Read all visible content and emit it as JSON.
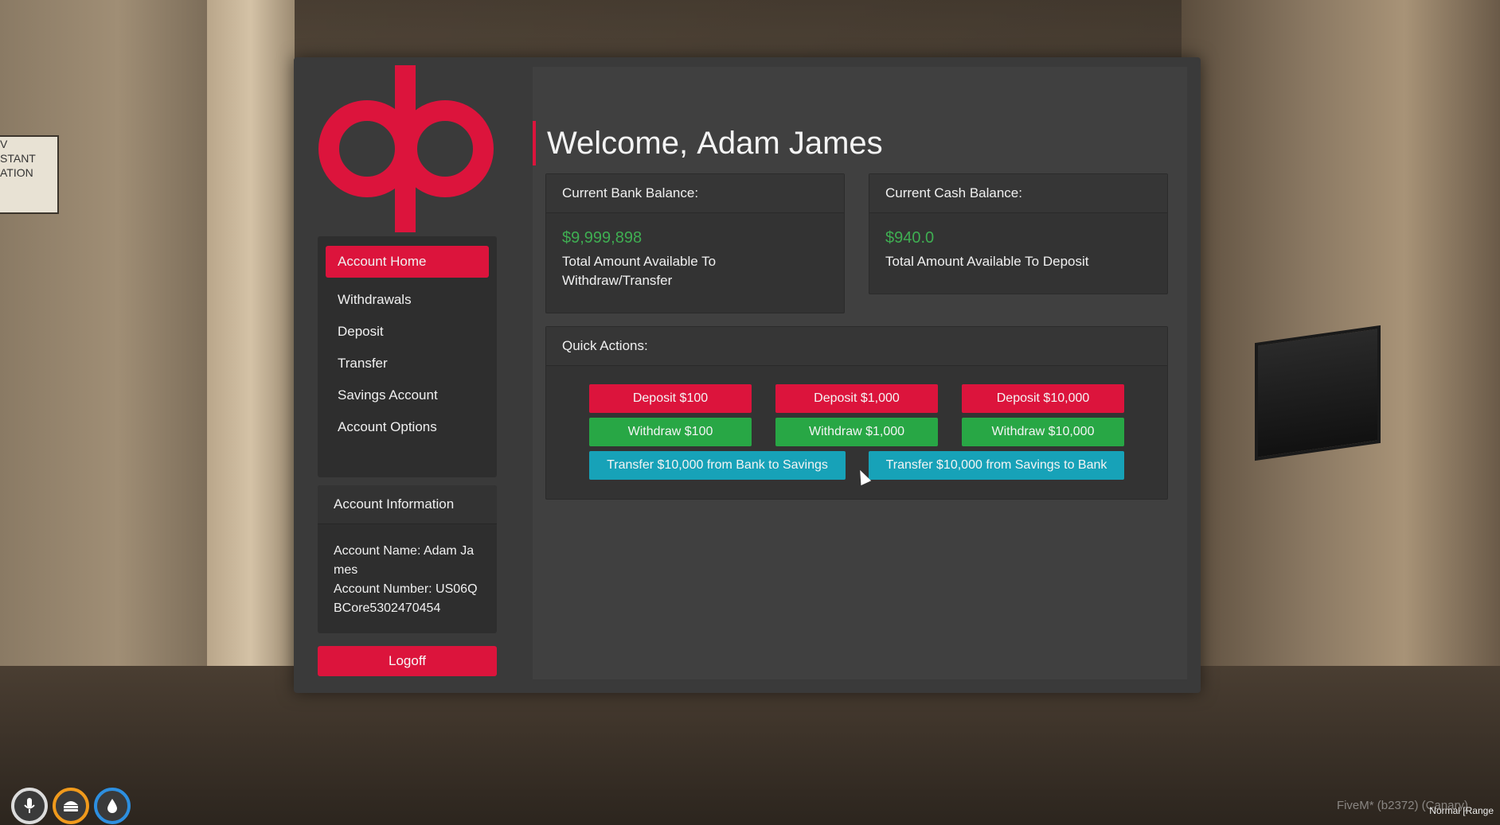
{
  "background": {
    "sign_lines": [
      "V",
      "STANT",
      "ATION"
    ]
  },
  "colors": {
    "accent": "#dc143c",
    "success": "#28a745",
    "info": "#17a2b8",
    "amount": "#3fae52"
  },
  "logo": {
    "icon": "qb-logo"
  },
  "sidebar": {
    "items": [
      {
        "label": "Account Home",
        "active": true
      },
      {
        "label": "Withdrawals"
      },
      {
        "label": "Deposit"
      },
      {
        "label": "Transfer"
      },
      {
        "label": "Savings Account"
      },
      {
        "label": "Account Options"
      }
    ]
  },
  "account_info": {
    "title": "Account Information",
    "name_line": "Account Name: Adam James",
    "number_line": "Account Number: US06QBCore5302470454"
  },
  "logoff_label": "Logoff",
  "welcome": {
    "prefix": "Welcome,",
    "name": "Adam James"
  },
  "bank_card": {
    "title": "Current Bank Balance:",
    "amount": "$9,999,898",
    "subtitle": "Total Amount Available To Withdraw/Transfer"
  },
  "cash_card": {
    "title": "Current Cash Balance:",
    "amount": "$940.0",
    "subtitle": "Total Amount Available To Deposit"
  },
  "quick_actions": {
    "title": "Quick Actions:",
    "deposit": [
      "Deposit $100",
      "Deposit $1,000",
      "Deposit $10,000"
    ],
    "withdraw": [
      "Withdraw $100",
      "Withdraw $1,000",
      "Withdraw $10,000"
    ],
    "transfer_to_savings": "Transfer $10,000 from Bank to Savings",
    "transfer_to_bank": "Transfer $10,000 from Savings to Bank"
  },
  "hud": {
    "icons": [
      "microphone-icon",
      "burger-icon",
      "water-drop-icon"
    ]
  },
  "watermark": "FiveM* (b2372) (Canary)",
  "voice_badge": "Normal [Range"
}
